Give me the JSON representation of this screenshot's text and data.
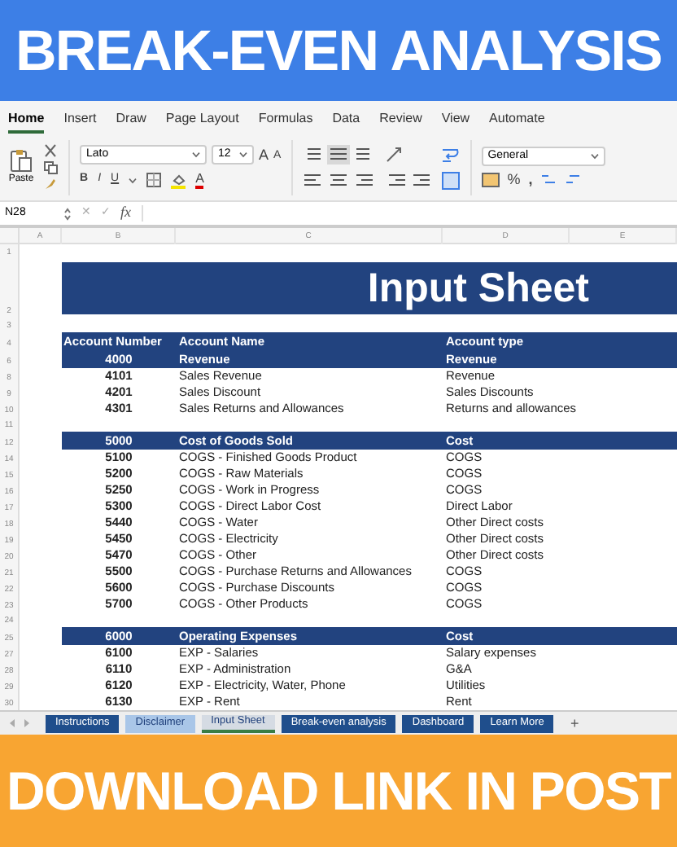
{
  "top_banner": "BREAK-EVEN ANALYSIS",
  "ribbon_tabs": [
    {
      "label": "Home",
      "selected": true
    },
    {
      "label": "Insert",
      "selected": false
    },
    {
      "label": "Draw",
      "selected": false
    },
    {
      "label": "Page Layout",
      "selected": false
    },
    {
      "label": "Formulas",
      "selected": false
    },
    {
      "label": "Data",
      "selected": false
    },
    {
      "label": "Review",
      "selected": false
    },
    {
      "label": "View",
      "selected": false
    },
    {
      "label": "Automate",
      "selected": false
    }
  ],
  "ribbon": {
    "paste_label": "Paste",
    "font_name": "Lato",
    "font_size": "12",
    "grow_font": "A",
    "shrink_font": "A",
    "bold": "B",
    "italic": "I",
    "underline": "U",
    "font_color": "A",
    "number_format": "General",
    "percent": "%",
    "comma": ","
  },
  "formula_bar": {
    "cell_ref": "N28",
    "cancel": "✕",
    "enter": "✓",
    "fx": "fx"
  },
  "columns": [
    "A",
    "B",
    "C",
    "D",
    "E"
  ],
  "rows": [
    {
      "row": "1",
      "kind": "blank"
    },
    {
      "row": "2",
      "kind": "title",
      "text": "Input Sheet"
    },
    {
      "row": "3",
      "kind": "blank"
    },
    {
      "row": "4",
      "kind": "header",
      "cells": [
        "Account Number",
        "Account Name",
        "Account type"
      ]
    },
    {
      "row": "6",
      "kind": "section",
      "cells": [
        "4000",
        "Revenue",
        "Revenue"
      ]
    },
    {
      "row": "8",
      "kind": "item",
      "cells": [
        "4101",
        "Sales Revenue",
        "Revenue"
      ]
    },
    {
      "row": "9",
      "kind": "item",
      "cells": [
        "4201",
        "Sales Discount",
        "Sales Discounts"
      ]
    },
    {
      "row": "10",
      "kind": "item",
      "cells": [
        "4301",
        "Sales Returns and Allowances",
        "Returns and allowances"
      ]
    },
    {
      "row": "11",
      "kind": "blank"
    },
    {
      "row": "12",
      "kind": "section",
      "cells": [
        "5000",
        "Cost of Goods Sold",
        "Cost"
      ]
    },
    {
      "row": "14",
      "kind": "item",
      "cells": [
        "5100",
        "COGS - Finished Goods Product",
        "COGS"
      ]
    },
    {
      "row": "15",
      "kind": "item",
      "cells": [
        "5200",
        "COGS - Raw Materials",
        "COGS"
      ]
    },
    {
      "row": "16",
      "kind": "item",
      "cells": [
        "5250",
        "COGS - Work in Progress",
        "COGS"
      ]
    },
    {
      "row": "17",
      "kind": "item",
      "cells": [
        "5300",
        "COGS - Direct Labor Cost",
        "Direct Labor"
      ]
    },
    {
      "row": "18",
      "kind": "item",
      "cells": [
        "5440",
        "COGS - Water",
        "Other Direct costs"
      ]
    },
    {
      "row": "19",
      "kind": "item",
      "cells": [
        "5450",
        "COGS - Electricity",
        "Other Direct costs"
      ]
    },
    {
      "row": "20",
      "kind": "item",
      "cells": [
        "5470",
        "COGS - Other",
        "Other Direct costs"
      ]
    },
    {
      "row": "21",
      "kind": "item",
      "cells": [
        "5500",
        "COGS - Purchase Returns and Allowances",
        "COGS"
      ]
    },
    {
      "row": "22",
      "kind": "item",
      "cells": [
        "5600",
        "COGS - Purchase Discounts",
        "COGS"
      ]
    },
    {
      "row": "23",
      "kind": "item",
      "cells": [
        "5700",
        "COGS - Other Products",
        "COGS"
      ]
    },
    {
      "row": "24",
      "kind": "blank"
    },
    {
      "row": "25",
      "kind": "section",
      "cells": [
        "6000",
        "Operating Expenses",
        "Cost"
      ]
    },
    {
      "row": "27",
      "kind": "item",
      "cells": [
        "6100",
        "EXP - Salaries",
        "Salary expenses"
      ]
    },
    {
      "row": "28",
      "kind": "item",
      "cells": [
        "6110",
        "EXP - Administration",
        "G&A"
      ]
    },
    {
      "row": "29",
      "kind": "item",
      "cells": [
        "6120",
        "EXP - Electricity, Water, Phone",
        "Utilities"
      ]
    },
    {
      "row": "30",
      "kind": "item",
      "cells": [
        "6130",
        "EXP - Rent",
        "Rent"
      ]
    }
  ],
  "sheet_tabs": [
    {
      "label": "Instructions",
      "selected": false,
      "color": "#1f4e8c"
    },
    {
      "label": "Disclaimer",
      "selected": false,
      "color": "#a9c6e8"
    },
    {
      "label": "Input Sheet",
      "selected": true,
      "color": "#d5dbe3"
    },
    {
      "label": "Break-even analysis",
      "selected": false,
      "color": "#1f4e8c"
    },
    {
      "label": "Dashboard",
      "selected": false,
      "color": "#1f4e8c"
    },
    {
      "label": "Learn More",
      "selected": false,
      "color": "#1f4e8c"
    }
  ],
  "add_sheet": "+",
  "bottom_banner": "DOWNLOAD LINK IN POST"
}
